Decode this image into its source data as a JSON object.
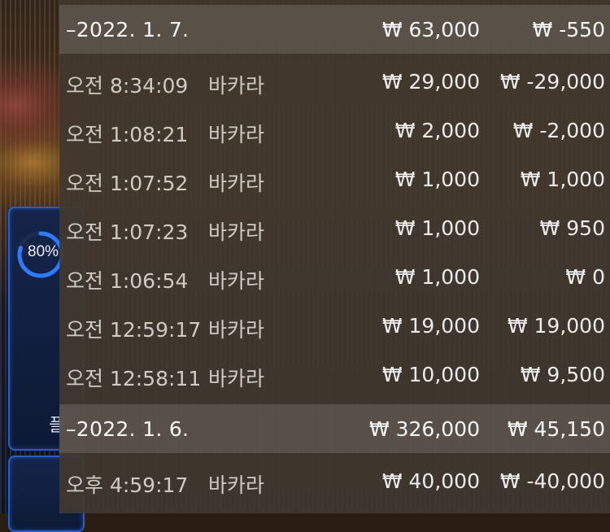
{
  "game": {
    "progress_label": "80%",
    "progress_value": 0.8,
    "card_glyph": "플",
    "accent_color": "#2f7bff"
  },
  "history": {
    "groups": [
      {
        "date": "–2022. 1. 7.",
        "total_bet": "₩ 63,000",
        "total_result": "₩ -550",
        "entries": [
          {
            "time": "오전 8:34:09",
            "game": "바카라",
            "bet": "₩ 29,000",
            "result": "₩ -29,000"
          },
          {
            "time": "오전 1:08:21",
            "game": "바카라",
            "bet": "₩ 2,000",
            "result": "₩ -2,000"
          },
          {
            "time": "오전 1:07:52",
            "game": "바카라",
            "bet": "₩ 1,000",
            "result": "₩ 1,000"
          },
          {
            "time": "오전 1:07:23",
            "game": "바카라",
            "bet": "₩ 1,000",
            "result": "₩ 950"
          },
          {
            "time": "오전 1:06:54",
            "game": "바카라",
            "bet": "₩ 1,000",
            "result": "₩ 0"
          },
          {
            "time": "오전 12:59:17",
            "game": "바카라",
            "bet": "₩ 19,000",
            "result": "₩ 19,000"
          },
          {
            "time": "오전 12:58:11",
            "game": "바카라",
            "bet": "₩ 10,000",
            "result": "₩ 9,500"
          }
        ]
      },
      {
        "date": "–2022. 1. 6.",
        "total_bet": "₩ 326,000",
        "total_result": "₩ 45,150",
        "entries": [
          {
            "time": "오후 4:59:17",
            "game": "바카라",
            "bet": "₩ 40,000",
            "result": "₩ -40,000"
          }
        ]
      }
    ]
  }
}
